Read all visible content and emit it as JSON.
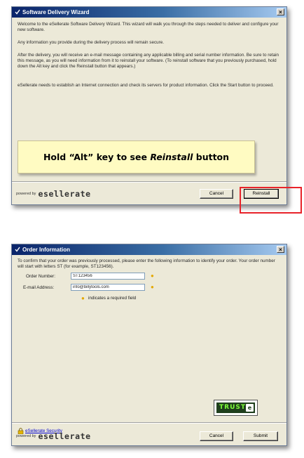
{
  "wizard": {
    "title": "Software Delivery Wizard",
    "paragraphs": [
      "Welcome to the eSellerate Software Delivery Wizard. This wizard will walk you through the steps needed to deliver and configure your new software.",
      "Any information you provide during the delivery process will remain secure.",
      "After the delivery, you will receive an e-mail message containing any applicable billing and serial number information. Be sure to retain this message, as you will need information from it to reinstall your software. (To reinstall software that you previously purchased, hold down the Alt key and click the Reinstall button that appears.)",
      "eSellerate needs to establish an Internet connection and check its servers for product information. Click the Start button to proceed."
    ],
    "callout": {
      "before": "Hold “Alt” key to see ",
      "emphasis": "Reinstall",
      "after": " button"
    },
    "powered_by": "powered by",
    "brand": "esellerate",
    "cancel_label": "Cancel",
    "reinstall_label": "Reinstall"
  },
  "order": {
    "title": "Order Information",
    "intro": "To confirm that your order was previously processed, please enter the following information to identify your order. Your order number will start with letters ST (for example, ST123456).",
    "order_number_label": "Order Number:",
    "order_number_value": "ST123456",
    "email_label": "E-mail Address:",
    "email_value": "info@billytools.com",
    "required_note": "indicates a required field",
    "trust_label": "TRUST",
    "trust_mark": "e",
    "security_link": "eSellerate Security",
    "powered_by": "powered by",
    "brand": "esellerate",
    "cancel_label": "Cancel",
    "submit_label": "Submit"
  },
  "colors": {
    "highlight": "#e8232a",
    "callout_bg": "#fffbc2",
    "required_marker": "#e3a800",
    "title_bar": "#0a246a"
  }
}
